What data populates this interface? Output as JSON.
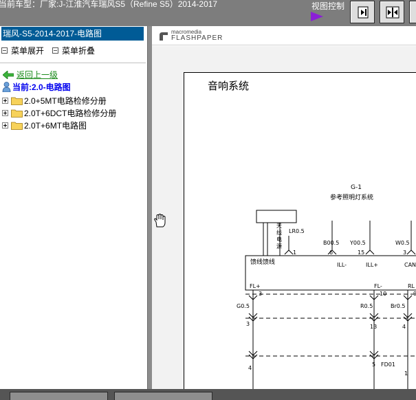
{
  "header": {
    "car_title": "当前车型：厂家:J-江淮汽车瑞风S5（Refine S5）2014-2017",
    "view_control_label": "视图控制"
  },
  "sidebar": {
    "doc_title": "瑞风-S5-2014-2017-电路图",
    "menu_expand": "菜单展开",
    "menu_collapse": "菜单折叠",
    "back_link": "返回上一级",
    "current": "当前:2.0-电路图",
    "tree": [
      {
        "label": "2.0+5MT电路检修分册"
      },
      {
        "label": "2.0T+6DCT电路检修分册"
      },
      {
        "label": "2.0T+6MT电路图"
      }
    ]
  },
  "viewer": {
    "brand_small": "macromedia",
    "brand_big": "FLASHPAPER"
  },
  "diagram": {
    "title": "音响系统",
    "g1_label": "G-1",
    "g1_sub": "参考照明灯系统",
    "antenna_label_1": "天",
    "antenna_label_2": "线",
    "antenna_label_3": "电",
    "antenna_label_4": "源",
    "wire_lr": "LR0.5",
    "wire_b00": "B00.5",
    "wire_y00": "Y00.5",
    "wire_w0": "W0.5",
    "pin_6": "6",
    "pin_15": "15",
    "pin_3a": "3",
    "pin_1": "1",
    "block_label": "馈线馈线",
    "ill_minus": "ILL-",
    "ill_plus": "ILL+",
    "can_label": "CAN",
    "fl_plus": "FL+",
    "fl_minus": "FL-",
    "rl_label": "RL",
    "pin_3b": "3",
    "pin_10": "10",
    "pin_9": "9",
    "wire_g0": "G0.5",
    "wire_r0": "R0.5",
    "wire_br": "Br0.5",
    "pin_3c": "3",
    "pin_13": "13",
    "pin_4a": "4",
    "pin_4b": "4",
    "pin_5": "5",
    "fd01": "FD01",
    "pin_1b": "1"
  },
  "colors": {
    "header_bg": "#7d7d7d",
    "title_bar": "#005b96",
    "back_link": "#1a8a1a",
    "current_link": "#0000ee",
    "view_arrow": "#8b1fd6"
  }
}
